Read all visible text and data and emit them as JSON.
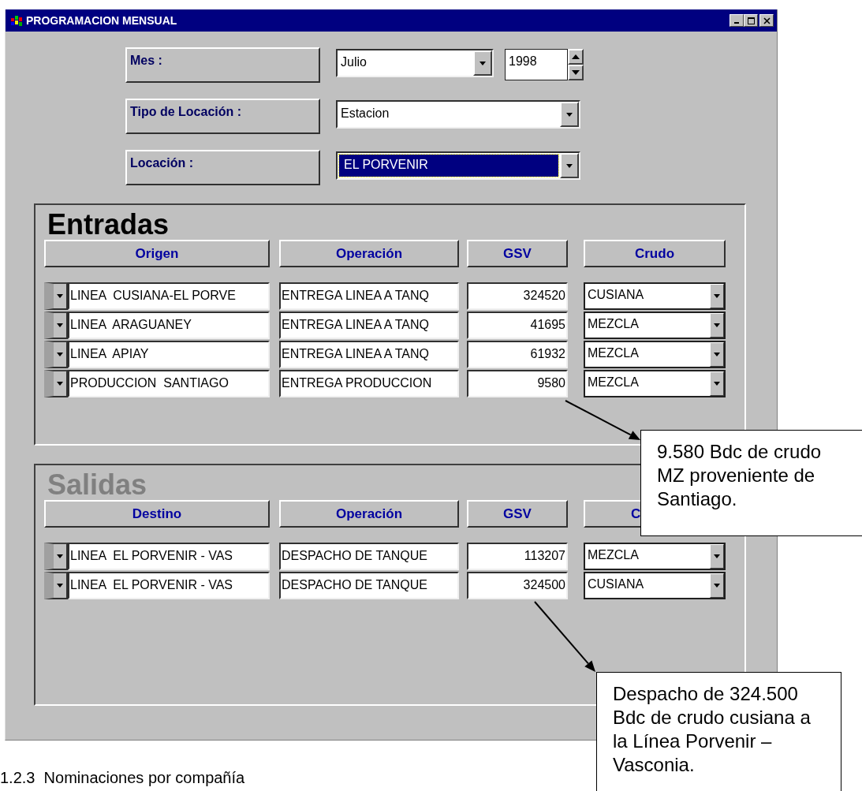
{
  "window": {
    "title": "PROGRAMACION MENSUAL"
  },
  "filters": [
    {
      "kind": "month",
      "label": "Mes :",
      "value": "Julio",
      "year": "1998",
      "focused": false
    },
    {
      "kind": "combo",
      "label": "Tipo de Locación :",
      "value": "Estacion",
      "focused": false
    },
    {
      "kind": "combo",
      "label": "Locación :",
      "value": "EL PORVENIR",
      "focused": true
    }
  ],
  "sections": [
    {
      "title": "Entradas",
      "active": true,
      "last_column_cut": false,
      "columns": [
        "Origen",
        "Operación",
        "GSV",
        "Crudo"
      ],
      "rows": [
        {
          "place": "LINEA  CUSIANA-EL PORVE",
          "operation": "ENTREGA LINEA A TANQ",
          "gsv": "324520",
          "crude": "CUSIANA"
        },
        {
          "place": "LINEA  ARAGUANEY",
          "operation": "ENTREGA LINEA A TANQ",
          "gsv": "41695",
          "crude": "MEZCLA"
        },
        {
          "place": "LINEA  APIAY",
          "operation": "ENTREGA LINEA A TANQ",
          "gsv": "61932",
          "crude": "MEZCLA"
        },
        {
          "place": "PRODUCCION  SANTIAGO",
          "operation": "ENTREGA PRODUCCION",
          "gsv": "9580",
          "crude": "MEZCLA"
        }
      ]
    },
    {
      "title": "Salidas",
      "active": false,
      "last_column_cut": true,
      "columns": [
        "Destino",
        "Operación",
        "GSV",
        "C"
      ],
      "rows": [
        {
          "place": "LINEA  EL PORVENIR - VAS",
          "operation": "DESPACHO DE TANQUE",
          "gsv": "113207",
          "crude": "MEZCLA"
        },
        {
          "place": "LINEA  EL PORVENIR - VAS",
          "operation": "DESPACHO DE TANQUE",
          "gsv": "324500",
          "crude": "CUSIANA"
        }
      ]
    }
  ],
  "callouts": [
    {
      "text": "9.580 Bdc de crudo MZ proveniente de Santiago."
    },
    {
      "text": "Despacho de 324.500 Bdc de crudo cusiana a la Línea Porvenir – Vasconia."
    }
  ],
  "footer": "1.2.3  Nominaciones por compañía"
}
